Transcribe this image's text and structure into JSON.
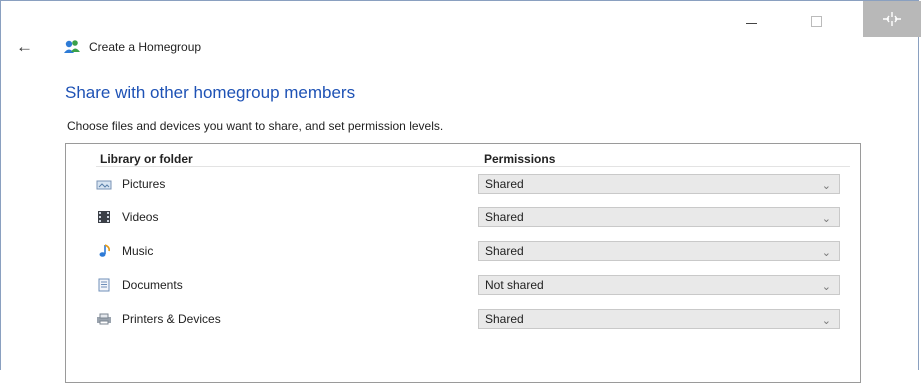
{
  "window": {
    "title": "Create a Homegroup",
    "minimize_icon": "minimize-icon",
    "maximize_icon": "maximize-icon",
    "close_icon": "close-icon",
    "close_bg": "#b8b8b8"
  },
  "nav": {
    "back_icon": "back-arrow-icon"
  },
  "content": {
    "heading": "Share with other homegroup members",
    "subtext": "Choose files and devices you want to share, and set permission levels.",
    "accent": "#1e52b5"
  },
  "table": {
    "col_library": "Library or folder",
    "col_permissions": "Permissions",
    "rows": [
      {
        "label": "Pictures",
        "icon": "pictures-icon",
        "permission": "Shared"
      },
      {
        "label": "Videos",
        "icon": "videos-icon",
        "permission": "Shared"
      },
      {
        "label": "Music",
        "icon": "music-icon",
        "permission": "Shared"
      },
      {
        "label": "Documents",
        "icon": "documents-icon",
        "permission": "Not shared"
      },
      {
        "label": "Printers & Devices",
        "icon": "printer-icon",
        "permission": "Shared"
      }
    ]
  }
}
